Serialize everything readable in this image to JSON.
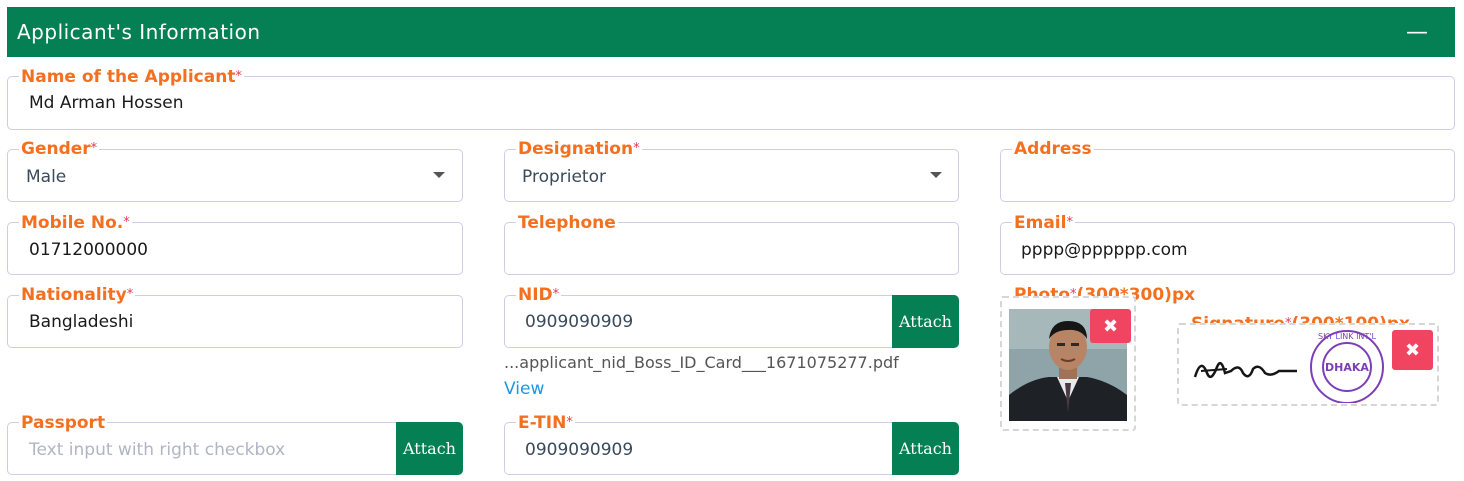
{
  "header": {
    "title": "Applicant's Information",
    "collapse_symbol": "—"
  },
  "fields": {
    "name": {
      "label": "Name of the Applicant",
      "required": "*",
      "value": "Md Arman Hossen"
    },
    "gender": {
      "label": "Gender",
      "required": "*",
      "value": "Male"
    },
    "designation": {
      "label": "Designation",
      "required": "*",
      "value": "Proprietor"
    },
    "address": {
      "label": "Address",
      "value": ""
    },
    "mobile": {
      "label": "Mobile No.",
      "required": "*",
      "value": "01712000000"
    },
    "telephone": {
      "label": "Telephone",
      "value": ""
    },
    "email": {
      "label": "Email",
      "required": "*",
      "value": "pppp@pppppp.com"
    },
    "nationality": {
      "label": "Nationality",
      "required": "*",
      "value": "Bangladeshi"
    },
    "nid": {
      "label": "NID",
      "required": "*",
      "value": "0909090909",
      "attach_label": "Attach",
      "filename": "...applicant_nid_Boss_ID_Card___1671075277.pdf",
      "view_label": "View"
    },
    "passport": {
      "label": "Passport",
      "placeholder": "Text input with right checkbox",
      "attach_label": "Attach"
    },
    "etin": {
      "label": "E-TIN",
      "required": "*",
      "value": "0909090909",
      "attach_label": "Attach"
    },
    "photo": {
      "label": "Photo",
      "required": "*",
      "size_hint": "(300*300)px",
      "remove_symbol": "✖"
    },
    "signature": {
      "label": "Signature",
      "required": "*",
      "size_hint": "(300*100)px",
      "remove_symbol": "✖",
      "stamp_text": "DHAKA",
      "stamp_ring_text": "SKY LINK INT'L"
    }
  },
  "colors": {
    "header_bg": "#058055",
    "label": "#f37021",
    "required": "#e53950",
    "attach_bg": "#058055",
    "remove_bg": "#f04460",
    "link": "#1e96e0"
  }
}
